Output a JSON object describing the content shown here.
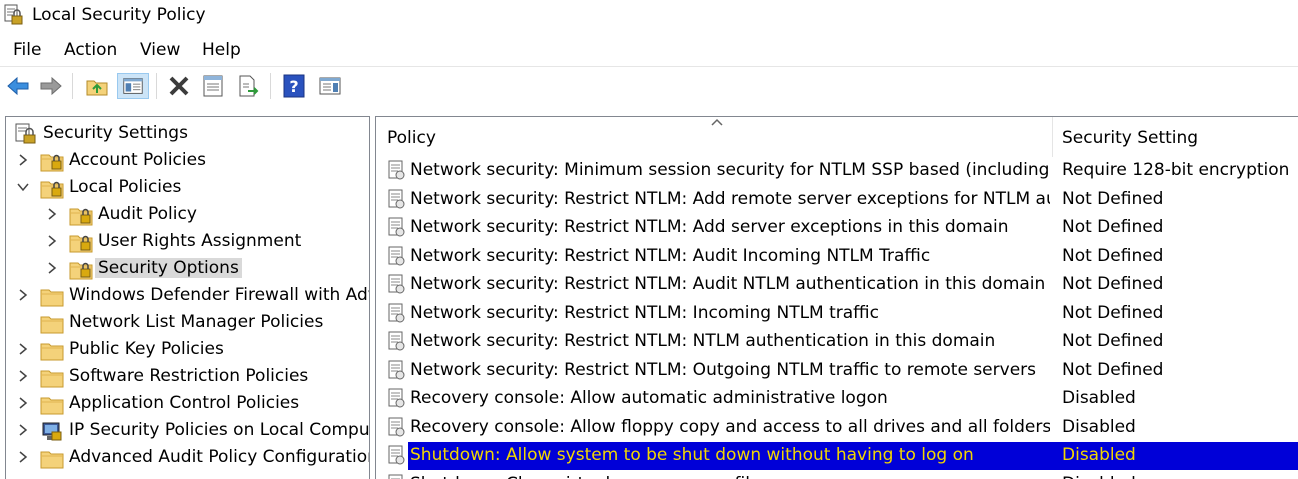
{
  "window": {
    "title": "Local Security Policy"
  },
  "menu": [
    "File",
    "Action",
    "View",
    "Help"
  ],
  "toolbar": {
    "buttons": [
      "back",
      "forward",
      "up-folder",
      "show-hide-tree",
      "delete",
      "properties",
      "export-list",
      "help",
      "show-hide-action-pane"
    ]
  },
  "tree": {
    "root": "Security Settings",
    "items": [
      {
        "label": "Account Policies"
      },
      {
        "label": "Local Policies"
      },
      {
        "label": "Audit Policy"
      },
      {
        "label": "User Rights Assignment"
      },
      {
        "label": "Security Options"
      },
      {
        "label": "Windows Defender Firewall with Advanced Security"
      },
      {
        "label": "Network List Manager Policies"
      },
      {
        "label": "Public Key Policies"
      },
      {
        "label": "Software Restriction Policies"
      },
      {
        "label": "Application Control Policies"
      },
      {
        "label": "IP Security Policies on Local Computer"
      },
      {
        "label": "Advanced Audit Policy Configuration"
      }
    ]
  },
  "list": {
    "columns": {
      "policy": "Policy",
      "setting": "Security Setting"
    },
    "rows": [
      {
        "policy": "Network security: Minimum session security for NTLM SSP based (including secure RPC) servers",
        "setting": "Require 128-bit encryption"
      },
      {
        "policy": "Network security: Restrict NTLM: Add remote server exceptions for NTLM authentication",
        "setting": "Not Defined"
      },
      {
        "policy": "Network security: Restrict NTLM: Add server exceptions in this domain",
        "setting": "Not Defined"
      },
      {
        "policy": "Network security: Restrict NTLM: Audit Incoming NTLM Traffic",
        "setting": "Not Defined"
      },
      {
        "policy": "Network security: Restrict NTLM: Audit NTLM authentication in this domain",
        "setting": "Not Defined"
      },
      {
        "policy": "Network security: Restrict NTLM: Incoming NTLM traffic",
        "setting": "Not Defined"
      },
      {
        "policy": "Network security: Restrict NTLM: NTLM authentication in this domain",
        "setting": "Not Defined"
      },
      {
        "policy": "Network security: Restrict NTLM: Outgoing NTLM traffic to remote servers",
        "setting": "Not Defined"
      },
      {
        "policy": "Recovery console: Allow automatic administrative logon",
        "setting": "Disabled"
      },
      {
        "policy": "Recovery console: Allow floppy copy and access to all drives and all folders",
        "setting": "Disabled"
      },
      {
        "policy": "Shutdown: Allow system to be shut down without having to log on",
        "setting": "Disabled"
      },
      {
        "policy": "Shutdown: Clear virtual memory pagefile",
        "setting": "Disabled"
      }
    ]
  },
  "colors": {
    "selection": "#0000d8",
    "selection_text": "#f2d600",
    "folder": "#f4d27a",
    "lock": "#c9a227"
  }
}
